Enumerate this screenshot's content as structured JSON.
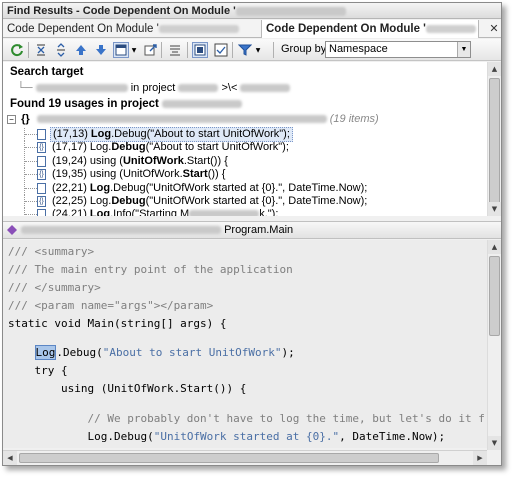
{
  "window": {
    "title": "Find Results - Code Dependent On Module '"
  },
  "tabs": [
    {
      "label": "Code Dependent On Module '"
    },
    {
      "label": "Code Dependent On Module '"
    }
  ],
  "toolbar": {
    "buttons": [
      "refresh-icon",
      "collapse-all-icon",
      "expand-all-icon",
      "previous-icon",
      "next-icon",
      "preview-icon",
      "export-icon",
      "merge-icon",
      "show-preview-icon",
      "options-icon",
      "filter-icon"
    ],
    "group_by_label": "Group by:",
    "group_by_value": "Namespace"
  },
  "results": {
    "search_target_heading": "Search target",
    "search_target_line": "in project",
    "search_target_suffix": ">\\<",
    "found_heading": "Found 19 usages in project",
    "namespace_items_count": "(19 items)",
    "rows": [
      {
        "loc": "(17,13)",
        "icon": "method",
        "pre": "",
        "bold": "Log",
        "post": ".Debug(\"About to start UnitOfWork\");",
        "selected": true
      },
      {
        "loc": "(17,17)",
        "icon": "bracket",
        "pre": "Log.",
        "bold": "Debug",
        "post": "(\"About to start UnitOfWork\");",
        "selected": false
      },
      {
        "loc": "(19,24)",
        "icon": "method",
        "pre": "using (",
        "bold": "UnitOfWork",
        "post": ".Start()) {",
        "selected": false
      },
      {
        "loc": "(19,35)",
        "icon": "bracket",
        "pre": "using (UnitOfWork.",
        "bold": "Start",
        "post": "()) {",
        "selected": false
      },
      {
        "loc": "(22,21)",
        "icon": "method",
        "pre": "",
        "bold": "Log",
        "post": ".Debug(\"UnitOfWork started at {0}.\", DateTime.Now);",
        "selected": false
      },
      {
        "loc": "(22,25)",
        "icon": "bracket",
        "pre": "Log.",
        "bold": "Debug",
        "post": "(\"UnitOfWork started at {0}.\", DateTime.Now);",
        "selected": false
      },
      {
        "loc": "(24,21)",
        "icon": "method",
        "pre": "",
        "bold": "Log",
        "post": ".Info(\"Starting M",
        "tail": "k.\");",
        "selected": false
      }
    ]
  },
  "code_header": {
    "path_suffix": "Program.Main"
  },
  "code": {
    "lines": [
      {
        "kind": "comment",
        "text": "/// <summary>"
      },
      {
        "kind": "comment",
        "text": "/// The main entry point of the application"
      },
      {
        "kind": "comment",
        "text": "/// </summary>"
      },
      {
        "kind": "comment",
        "text": "/// <param name=\"args\"></param>"
      },
      {
        "kind": "plain",
        "text": "static void Main(string[] args) {"
      },
      {
        "kind": "log",
        "indent": "    ",
        "hl": "Log",
        "mid": ".Debug(",
        "str": "\"About to start UnitOfWork\"",
        "end": ");"
      },
      {
        "kind": "plain",
        "text": "    try {"
      },
      {
        "kind": "plain",
        "text": "        using (UnitOfWork.Start()) {"
      },
      {
        "kind": "comment",
        "text": "            // We probably don't have to log the time, but let's do it f"
      },
      {
        "kind": "log2",
        "indent": "            ",
        "pre": "Log.Debug(",
        "str": "\"UnitOfWork started at {0}.\"",
        "end": ", DateTime.Now);"
      }
    ]
  }
}
